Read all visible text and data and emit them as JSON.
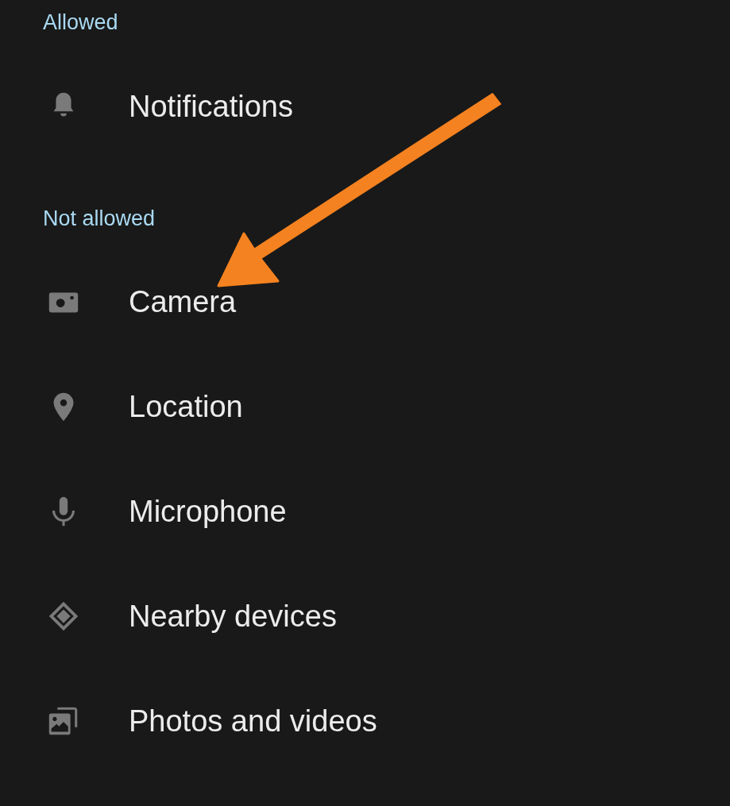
{
  "sections": [
    {
      "header": "Allowed",
      "items": [
        {
          "label": "Notifications",
          "kind": "bell"
        }
      ]
    },
    {
      "header": "Not allowed",
      "items": [
        {
          "label": "Camera",
          "kind": "camera"
        },
        {
          "label": "Location",
          "kind": "pin"
        },
        {
          "label": "Microphone",
          "kind": "mic"
        },
        {
          "label": "Nearby devices",
          "kind": "nearby"
        },
        {
          "label": "Photos and videos",
          "kind": "photos"
        }
      ]
    }
  ]
}
